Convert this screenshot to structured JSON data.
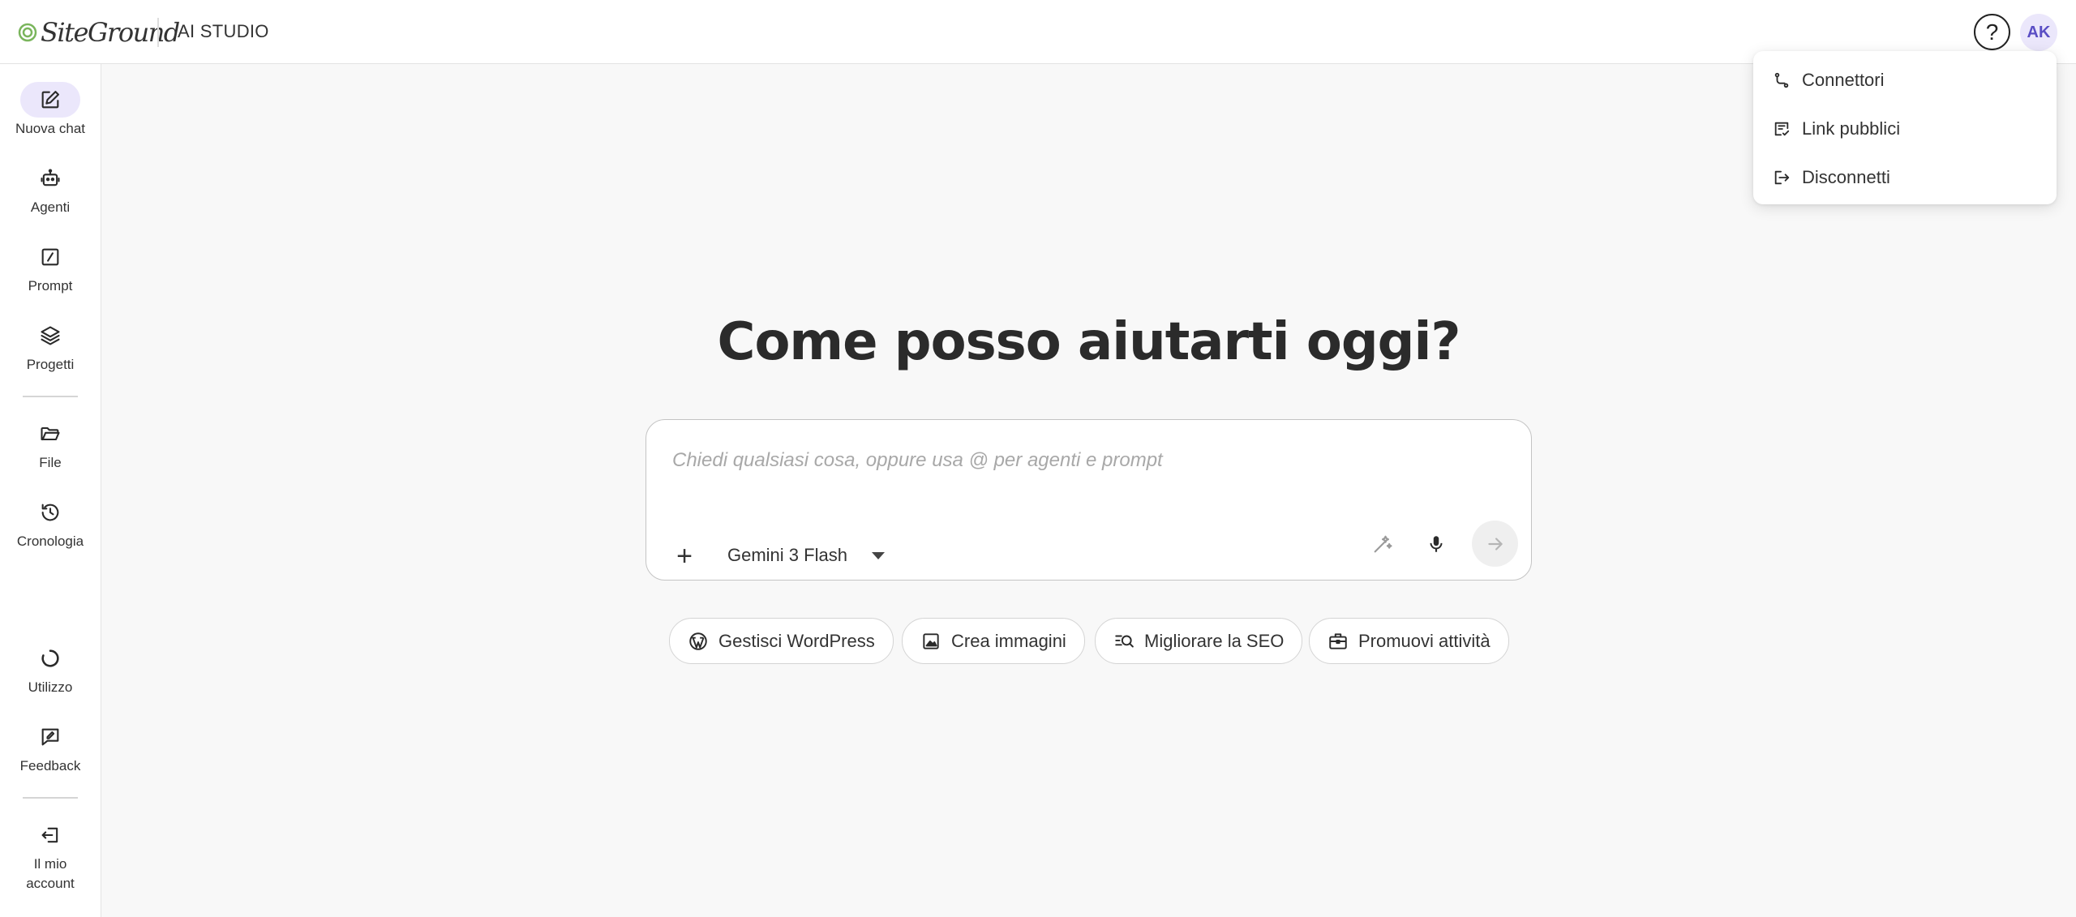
{
  "header": {
    "logo_text": "SiteGround",
    "app_title": "AI STUDIO",
    "help_glyph": "?",
    "avatar_initials": "AK"
  },
  "colors": {
    "accent_soft": "#ebe7fb",
    "accent_text": "#5a4ec4",
    "logo_green": "#7ab55c"
  },
  "sidebar": {
    "items": [
      {
        "label": "Nuova chat",
        "icon": "edit-icon",
        "active": true
      },
      {
        "label": "Agenti",
        "icon": "robot-icon"
      },
      {
        "label": "Prompt",
        "icon": "prompt-icon"
      },
      {
        "label": "Progetti",
        "icon": "layers-icon"
      },
      {
        "label": "File",
        "icon": "folder-icon"
      },
      {
        "label": "Cronologia",
        "icon": "history-icon"
      },
      {
        "label": "Utilizzo",
        "icon": "usage-icon"
      },
      {
        "label": "Feedback",
        "icon": "feedback-icon"
      },
      {
        "label": "Il mio account",
        "icon": "account-icon"
      }
    ]
  },
  "main": {
    "headline": "Come posso aiutarti oggi?",
    "chat": {
      "placeholder": "Chiedi qualsiasi cosa, oppure usa @ per agenti e prompt",
      "value": "",
      "plus_glyph": "+",
      "model": "Gemini 3 Flash"
    },
    "chips": [
      {
        "label": "Gestisci WordPress",
        "icon": "wordpress-icon"
      },
      {
        "label": "Crea immagini",
        "icon": "image-icon"
      },
      {
        "label": "Migliorare la SEO",
        "icon": "seo-search-icon"
      },
      {
        "label": "Promuovi attività",
        "icon": "briefcase-icon"
      }
    ]
  },
  "menu": {
    "items": [
      {
        "label": "Connettori",
        "icon": "connector-icon"
      },
      {
        "label": "Link pubblici",
        "icon": "public-link-icon"
      },
      {
        "label": "Disconnetti",
        "icon": "logout-icon"
      }
    ]
  }
}
